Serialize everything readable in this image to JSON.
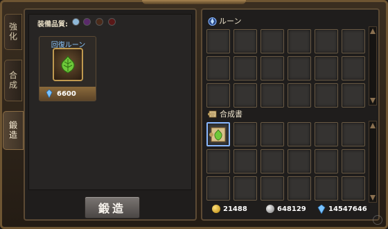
{
  "tabs": [
    {
      "label": "強化",
      "active": false
    },
    {
      "label": "合成",
      "active": false
    },
    {
      "label": "鍛造",
      "active": true
    }
  ],
  "forge": {
    "quality_label": "装備品質:",
    "quality_colors": [
      "#8fb8d8",
      "#5a2a6a",
      "#4a2a1a",
      "#5a1818"
    ],
    "rune_card": {
      "title": "回復ルーン",
      "icon": "green-leaf-rune-icon",
      "cost": "6600",
      "cost_icon": "blue-crystal-icon"
    },
    "button_label": "鍛造"
  },
  "inventory": {
    "rune_section_label": "ルーン",
    "rune_section_icon": "rune-drop-icon",
    "book_section_label": "合成書",
    "book_section_icon": "scroll-icon",
    "selected_book_icon": "green-leaf-scroll-icon"
  },
  "currency": {
    "gold": "21488",
    "silver": "648129",
    "crystal": "14547646"
  },
  "colors": {
    "frame": "#6e5532",
    "panel": "#1f1d1c",
    "accent_blue": "#8cc8ff",
    "gold": "#d8a82c"
  }
}
